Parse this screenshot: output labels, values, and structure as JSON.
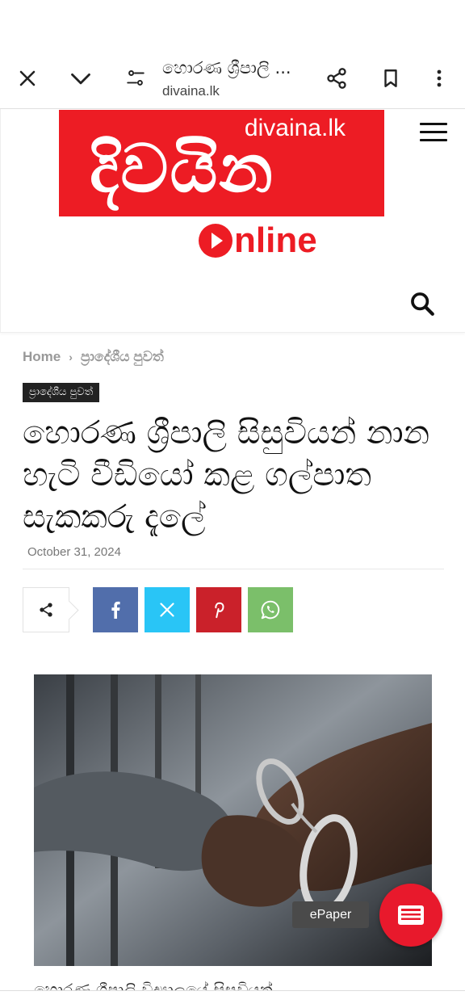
{
  "browser": {
    "page_title": "හොරණ ශ්‍රීපාලි ...",
    "domain": "divaina.lk",
    "icons": [
      "close-icon",
      "chevron-down-icon",
      "tune-icon",
      "share-icon",
      "bookmark-icon",
      "more-vert-icon"
    ]
  },
  "site": {
    "logo_domain": "divaina.lk",
    "logo_main": "දිවයින",
    "logo_online_word": "nline",
    "brand_color": "#ed1c24"
  },
  "article": {
    "breadcrumb": [
      "Home",
      "ප්‍රාදේශීය පුවත්"
    ],
    "breadcrumb_sep": "›",
    "category": "ප්‍රාදේශීය පුවත්",
    "headline": "හොරණ ශ්‍රීපාලි සිසුවියන් නාන හැටි වීඩියෝ කළ ගල්පාත සැකකරු දැලේ",
    "date": "October 31, 2024",
    "body_start": "හොරණ ශ්‍රීපාලි විද්‍යාලයේ සිසුවියන්"
  },
  "share": {
    "buttons": [
      {
        "id": "facebook",
        "glyph": "f",
        "color": "#516eab"
      },
      {
        "id": "x",
        "glyph": "𝕏",
        "color": "#29c5f6"
      },
      {
        "id": "pinterest",
        "glyph": "P",
        "color": "#ca212a"
      },
      {
        "id": "whatsapp",
        "glyph": "W",
        "color": "#7bbf6a"
      }
    ]
  },
  "epaper": {
    "label": "ePaper",
    "color": "#e8192c"
  }
}
